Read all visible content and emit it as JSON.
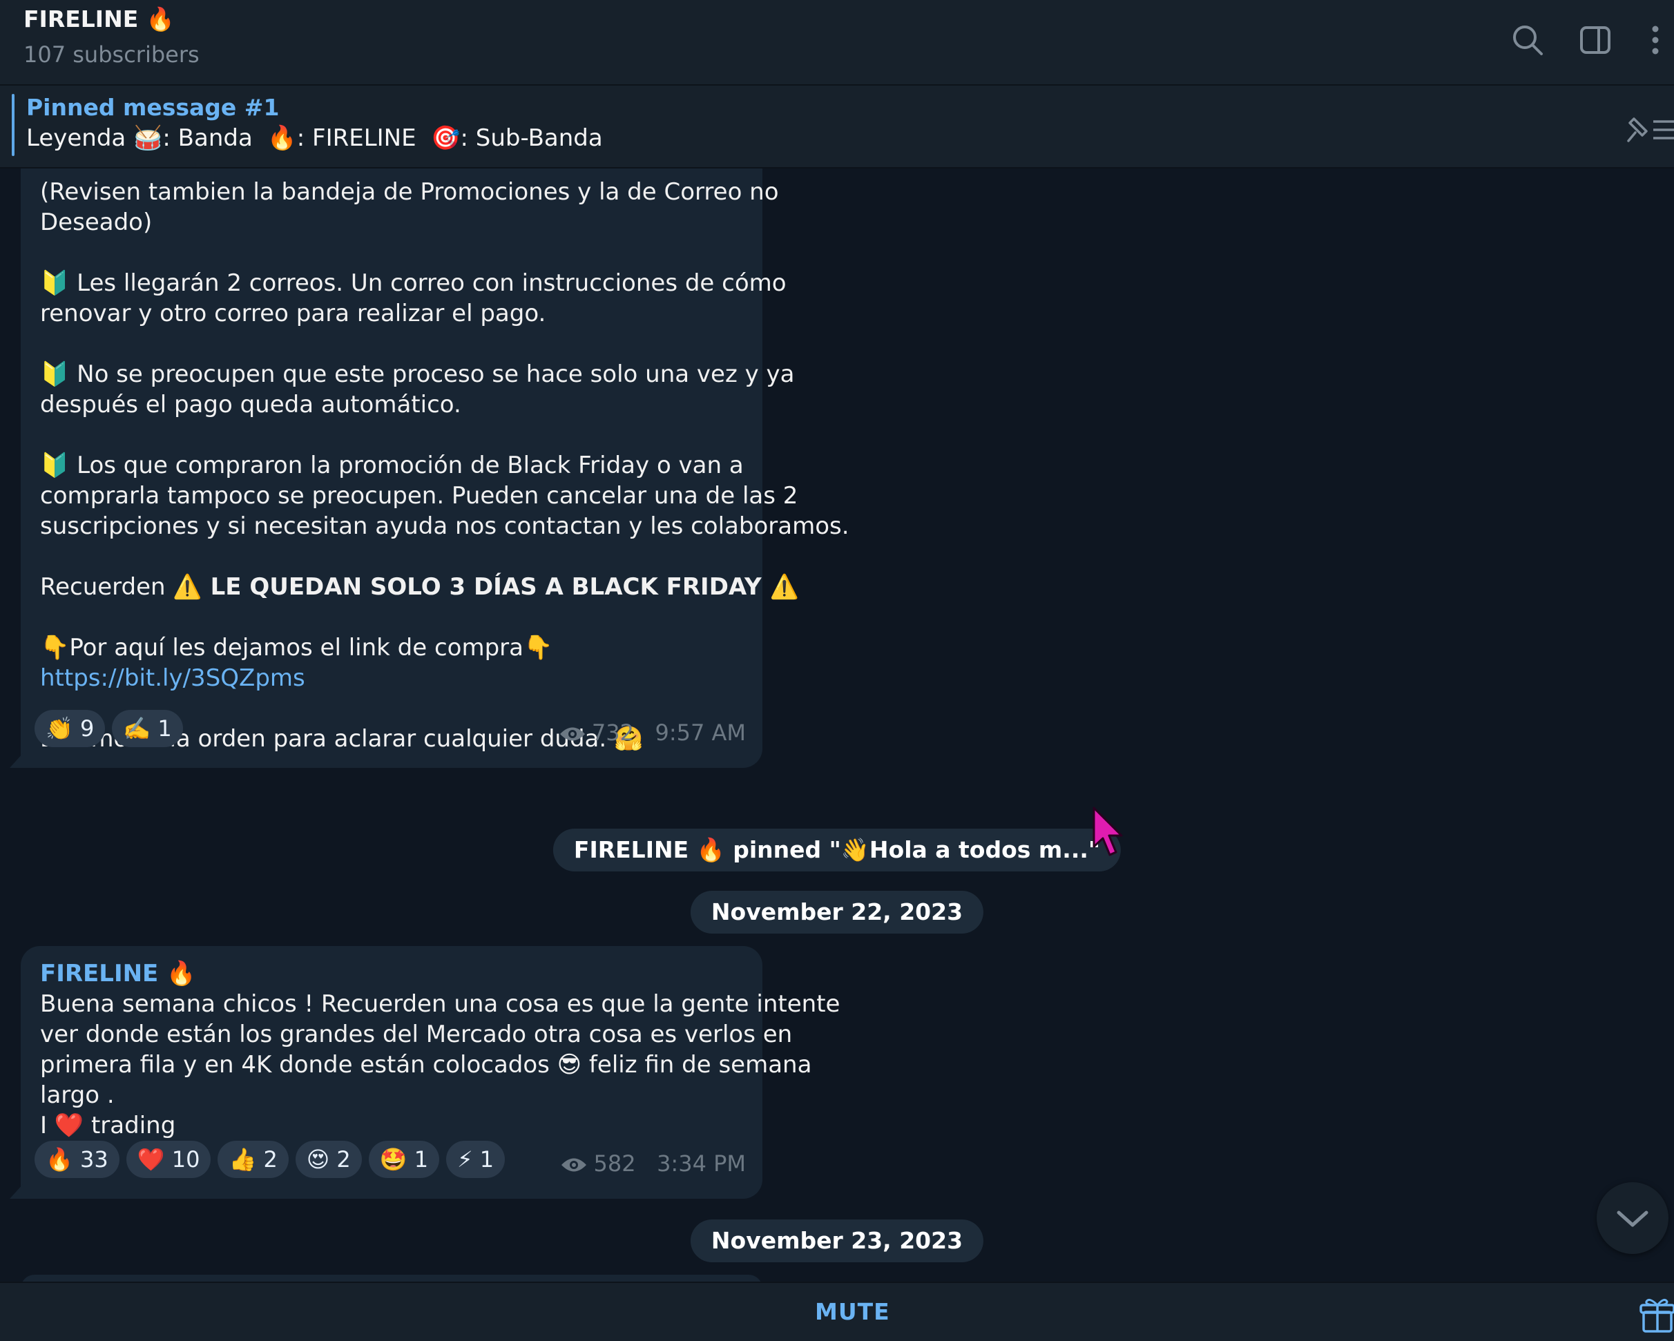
{
  "header": {
    "title": "FIRELINE 🔥",
    "subtitle": "107 subscribers",
    "icons": [
      "search-icon",
      "sidebar-toggle-icon",
      "more-options-icon"
    ]
  },
  "pinned": {
    "title": "Pinned message #1",
    "text": "Leyenda 🥁: Banda  🔥: FIRELINE  🎯: Sub-Banda"
  },
  "message1": {
    "lines": [
      "(Revisen tambien la bandeja de Promociones y la de Correo no",
      "Deseado)",
      "",
      "🔰 Les llegarán 2 correos. Un correo con instrucciones de cómo",
      "renovar y otro correo para realizar el pago.",
      "",
      "🔰 No se preocupen que este proceso se hace solo una vez y ya",
      "después el pago queda automático.",
      "",
      "🔰 Los que compraron la promoción de Black Friday o van a",
      "comprarla tampoco se preocupen. Pueden cancelar una de las 2",
      "suscripciones y si necesitan ayuda nos contactan y les colaboramos.",
      ""
    ],
    "recuerden_prefix": "Recuerden ",
    "recuerden_bold": "⚠️ LE QUEDAN SOLO 3 DÍAS A BLACK FRIDAY ⚠️",
    "link_intro": "👇Por aquí les dejamos el link de compra👇",
    "link": "https://bit.ly/3SQZpms",
    "closing": "Estamos a la orden para aclarar cualquier duda. 🤗",
    "reactions": [
      {
        "emoji": "👏",
        "count": "9"
      },
      {
        "emoji": "✍️",
        "count": "1"
      }
    ],
    "views": "732",
    "time": "9:57 AM"
  },
  "service_pin": "FIRELINE 🔥 pinned \"👋Hola a todos m...\"",
  "date1": "November 22, 2023",
  "message2": {
    "sender": "FIRELINE 🔥",
    "lines": [
      "Buena semana chicos ! Recuerden una cosa es que la gente intente",
      "ver donde están los grandes del Mercado otra cosa es verlos en",
      "primera fila y en 4K donde están colocados 😎 feliz fin de semana",
      "largo .",
      "I ❤️ trading"
    ],
    "reactions": [
      {
        "emoji": "🔥",
        "count": "33"
      },
      {
        "emoji": "❤️",
        "count": "10"
      },
      {
        "emoji": "👍",
        "count": "2"
      },
      {
        "emoji": "😍",
        "count": "2"
      },
      {
        "emoji": "🤩",
        "count": "1"
      },
      {
        "emoji": "⚡",
        "count": "1"
      }
    ],
    "views": "582",
    "time": "3:34 PM"
  },
  "date2": "November 23, 2023",
  "footer": {
    "mute_label": "MUTE"
  },
  "accent": "#6ab3f3",
  "background": "#0e1621"
}
